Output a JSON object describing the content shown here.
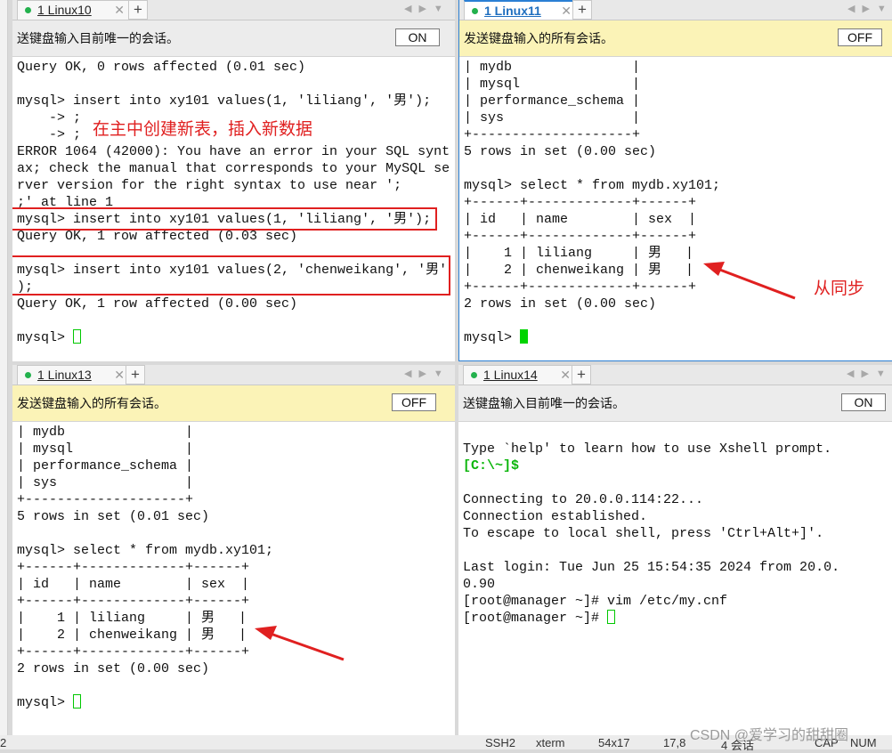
{
  "panes": [
    {
      "tab_label": "1 Linux10",
      "notice_text": "送键盘输入目前唯一的会话。",
      "toggle_label": "ON",
      "lines": [
        "Query OK, 0 rows affected (0.01 sec)",
        "",
        "mysql> insert into xy101 values(1, 'liliang', '男');",
        "    -> ;",
        "    -> ;",
        "ERROR 1064 (42000): You have an error in your SQL synt",
        "ax; check the manual that corresponds to your MySQL se",
        "rver version for the right syntax to use near ';",
        ";' at line 1",
        "mysql> insert into xy101 values(1, 'liliang', '男');",
        "Query OK, 1 row affected (0.03 sec)",
        "",
        "mysql> insert into xy101 values(2, 'chenweikang', '男'",
        ");",
        "Query OK, 1 row affected (0.00 sec)",
        "",
        "mysql> "
      ]
    },
    {
      "tab_label": "1 Linux11",
      "notice_text": "发送键盘输入的所有会话。",
      "toggle_label": "OFF",
      "lines": [
        "| mydb               |",
        "| mysql              |",
        "| performance_schema |",
        "| sys                |",
        "+--------------------+",
        "5 rows in set (0.00 sec)",
        "",
        "mysql> select * from mydb.xy101;",
        "+------+-------------+------+",
        "| id   | name        | sex  |",
        "+------+-------------+------+",
        "|    1 | liliang     | 男   |",
        "|    2 | chenweikang | 男   |",
        "+------+-------------+------+",
        "2 rows in set (0.00 sec)",
        "",
        "mysql> "
      ]
    },
    {
      "tab_label": "1 Linux13",
      "notice_text": "发送键盘输入的所有会话。",
      "toggle_label": "OFF",
      "lines": [
        "| mydb               |",
        "| mysql              |",
        "| performance_schema |",
        "| sys                |",
        "+--------------------+",
        "5 rows in set (0.01 sec)",
        "",
        "mysql> select * from mydb.xy101;",
        "+------+-------------+------+",
        "| id   | name        | sex  |",
        "+------+-------------+------+",
        "|    1 | liliang     | 男   |",
        "|    2 | chenweikang | 男   |",
        "+------+-------------+------+",
        "2 rows in set (0.00 sec)",
        "",
        "mysql> "
      ]
    },
    {
      "tab_label": "1 Linux14",
      "notice_text": "送键盘输入目前唯一的会话。",
      "toggle_label": "ON",
      "lines": [
        "",
        "Type `help' to learn how to use Xshell prompt.",
        "[C:\\~]$",
        "",
        "Connecting to 20.0.0.114:22...",
        "Connection established.",
        "To escape to local shell, press 'Ctrl+Alt+]'.",
        "",
        "Last login: Tue Jun 25 15:54:35 2024 from 20.0.",
        "0.90",
        "[root@manager ~]# vim /etc/my.cnf",
        "[root@manager ~]# "
      ]
    }
  ],
  "annotations": {
    "create_table_note": "在主中创建新表，插入新数据",
    "sync_note": "从同步"
  },
  "statusbar": {
    "left_fragment": "2",
    "protocol": "SSH2",
    "term_type": "xterm",
    "size": "54x17",
    "cursor_pos": "17,8",
    "sessions": "4 会话",
    "caps": "CAP",
    "num": "NUM"
  },
  "watermark": "CSDN @爱学习的甜甜圈",
  "colors": {
    "annotation_red": "#e02020",
    "prompt_green": "#0bb50b",
    "active_tab_blue": "#1f6fbf",
    "broadcast_yellow": "#fbf3b7"
  }
}
